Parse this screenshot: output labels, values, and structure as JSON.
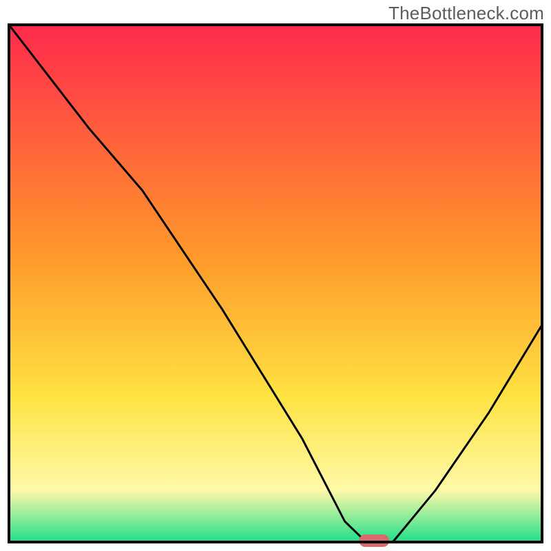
{
  "watermark": "TheBottleneck.com",
  "colors": {
    "red": "#ff2a4d",
    "orange": "#ff9a2a",
    "yellow": "#ffe343",
    "paleyellow": "#fff9a8",
    "green": "#1fe08a",
    "stroke": "#000000",
    "marker": "#d86a6a",
    "bg": "#ffffff"
  },
  "chart_data": {
    "type": "line",
    "title": "",
    "xlabel": "",
    "ylabel": "",
    "xlim": [
      0,
      100
    ],
    "ylim": [
      0,
      100
    ],
    "series": [
      {
        "name": "bottleneck-curve",
        "x": [
          0,
          15,
          25,
          40,
          55,
          63,
          67,
          72,
          80,
          90,
          100
        ],
        "values": [
          100,
          80,
          68,
          45,
          20,
          4,
          0,
          0,
          10,
          25,
          42
        ]
      }
    ],
    "annotations": [
      {
        "name": "optimal-marker",
        "x": 68.5,
        "y": 0
      }
    ]
  }
}
